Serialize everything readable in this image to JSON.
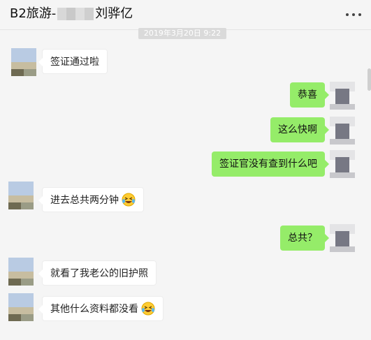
{
  "header": {
    "title_prefix": "B2旅游-",
    "title_suffix": "刘骅亿"
  },
  "timestamp": "2019年3月20日 9:22",
  "messages": [
    {
      "side": "in",
      "text": "签证通过啦"
    },
    {
      "side": "out",
      "text": "恭喜"
    },
    {
      "side": "out",
      "text": "这么快啊"
    },
    {
      "side": "out",
      "text": "签证官没有查到什么吧"
    },
    {
      "side": "in",
      "text": "进去总共两分钟",
      "emoji": "laughing-crying-emoji"
    },
    {
      "side": "out",
      "text": "总共？"
    },
    {
      "side": "in",
      "text": "就看了我老公的旧护照"
    },
    {
      "side": "in",
      "text": "其他什么资料都没看",
      "emoji": "laughing-crying-emoji"
    }
  ],
  "colors": {
    "outgoing_bubble": "#95ec69",
    "incoming_bubble": "#ffffff",
    "background": "#f5f5f5"
  },
  "icons": {
    "more": "more-dots-icon"
  }
}
